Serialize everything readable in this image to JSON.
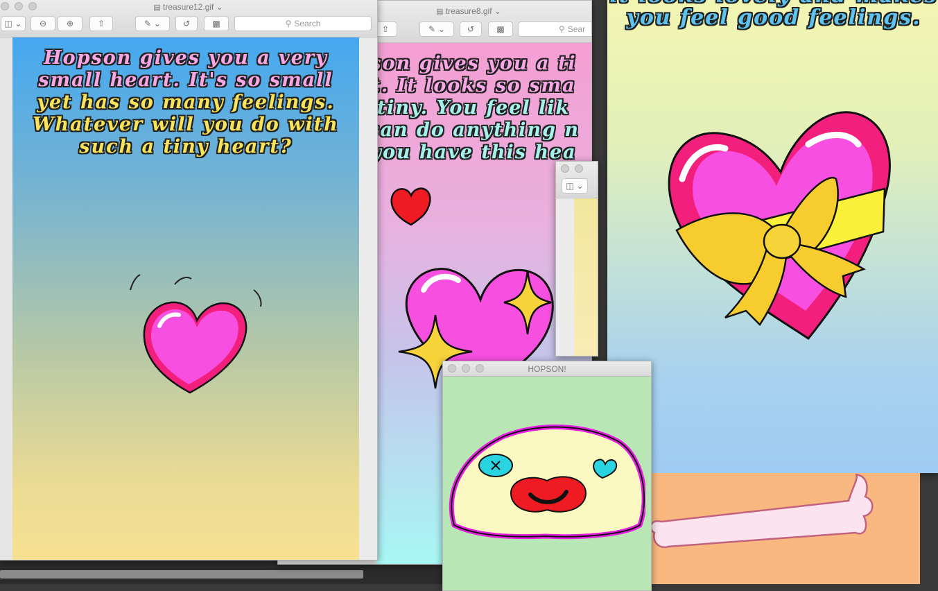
{
  "windows": {
    "treasure12": {
      "title": "treasure12.gif",
      "search_placeholder": "Search",
      "caption_lines": [
        "Hopson gives you a very",
        "small heart. It's so small",
        "yet has so many feelings.",
        "Whatever will you do with",
        "such a tiny heart?"
      ]
    },
    "treasure8": {
      "title": "treasure8.gif",
      "search_placeholder": "Sear",
      "caption_lines": [
        "son gives you a ti",
        "t. It looks so sma",
        "tiny. You feel lik",
        "can do anything n",
        "you have this hea"
      ]
    },
    "big_right": {
      "caption_lines": [
        "it looks lovely and makes",
        "you feel good feelings."
      ]
    },
    "hopson": {
      "title": "HOPSON!"
    }
  },
  "icons": [
    "sidebar-icon",
    "zoom-out-icon",
    "zoom-in-icon",
    "share-icon",
    "markup-icon",
    "rotate-icon",
    "toolbox-icon",
    "search-icon",
    "heart-icon",
    "sparkle-icon",
    "bone-icon"
  ],
  "colors": {
    "pink_heart": "#f74fe0",
    "hot_pink": "#f21f7d",
    "red_heart": "#ef1b23",
    "gold": "#f7cc2f",
    "hopson_body": "#fcf8c2",
    "hopson_bg": "#b8e6b5"
  }
}
